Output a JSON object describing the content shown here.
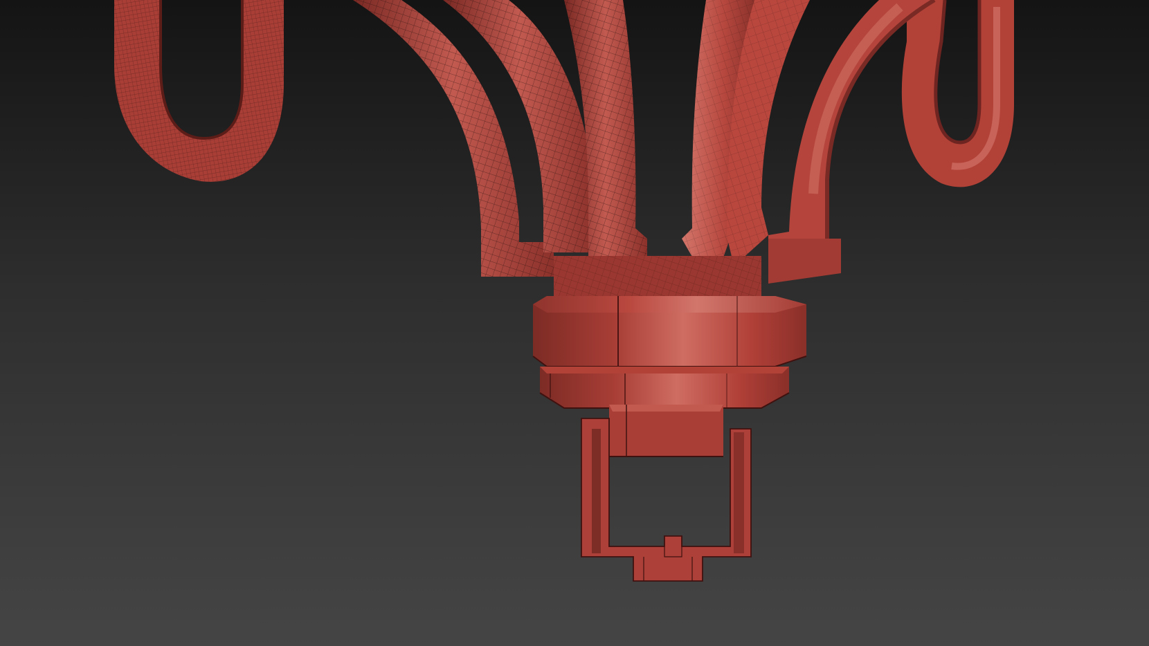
{
  "viewport": {
    "background_top": "#141414",
    "background_bottom": "#454545"
  },
  "model": {
    "base_color": "#b4443c",
    "light_color": "#d86a60",
    "dark_color": "#6e2420",
    "wire_color": "#1a0a08"
  },
  "icons": [
    "none"
  ]
}
